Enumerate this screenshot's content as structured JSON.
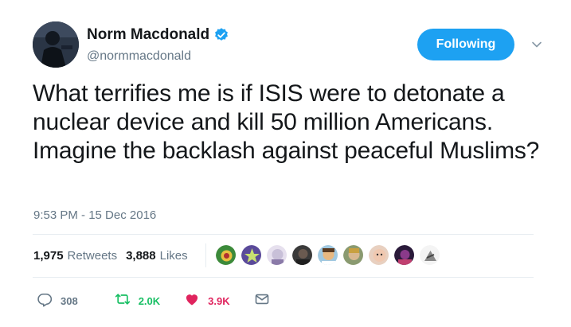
{
  "author": {
    "display_name": "Norm Macdonald",
    "handle": "@normmacdonald",
    "verified": true
  },
  "follow_button": {
    "label": "Following"
  },
  "tweet": {
    "text": "What terrifies me is if ISIS were to detonate a nuclear device and kill 50 million Americans. Imagine the backlash against peaceful Muslims?",
    "timestamp": "9:53 PM - 15 Dec 2016"
  },
  "stats": {
    "retweets_count": "1,975",
    "retweets_label": "Retweets",
    "likes_count": "3,888",
    "likes_label": "Likes"
  },
  "likers_avatar_colors": [
    "#3c8a3a",
    "#5a4a9a",
    "#c8c0d8",
    "#3a3a3a",
    "#d8a060",
    "#8a9a70",
    "#d8b0a0",
    "#6a3a5a",
    "#b8b8b8"
  ],
  "actions": {
    "reply_count": "308",
    "retweet_count": "2.0K",
    "like_count": "3.9K"
  },
  "colors": {
    "accent": "#1da1f2",
    "retweet": "#17bf63",
    "like": "#e0245e",
    "muted": "#657786"
  },
  "icons": [
    "verified-badge-icon",
    "chevron-down-icon",
    "reply-icon",
    "retweet-icon",
    "heart-icon",
    "envelope-icon"
  ]
}
